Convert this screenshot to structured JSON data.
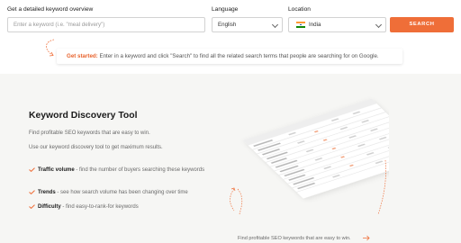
{
  "search": {
    "label": "Get a detailed keyword overview",
    "placeholder": "Enter a keyword (i.e. \"meal delivery\")",
    "value": ""
  },
  "language": {
    "label": "Language",
    "selected": "English"
  },
  "location": {
    "label": "Location",
    "selected": "India",
    "flag_icon": "india-flag-icon"
  },
  "search_button": {
    "label": "SEARCH",
    "color": "#ef6e38"
  },
  "tip": {
    "title": "Get started:",
    "text": " Enter in a keyword and click \"Search\" to find all the related search terms that people are searching for on Google."
  },
  "hero": {
    "title": "Keyword Discovery Tool",
    "line1": "Find profitable SEO keywords that are easy to win.",
    "line2": "Use our keyword discovery tool to get maximum results.",
    "features": [
      {
        "bold": "Traffic volume",
        "text": " - find the number of buyers searching these keywords"
      },
      {
        "bold": "Trends",
        "text": " - see how search volume has been changing over time"
      },
      {
        "bold": "Difficulty",
        "text": " - find easy-to-rank-for keywords"
      }
    ]
  },
  "bottom_note": "Find profitable SEO keywords that are easy to win.",
  "colors": {
    "accent": "#ef6e38",
    "background": "#f6f6f4"
  }
}
